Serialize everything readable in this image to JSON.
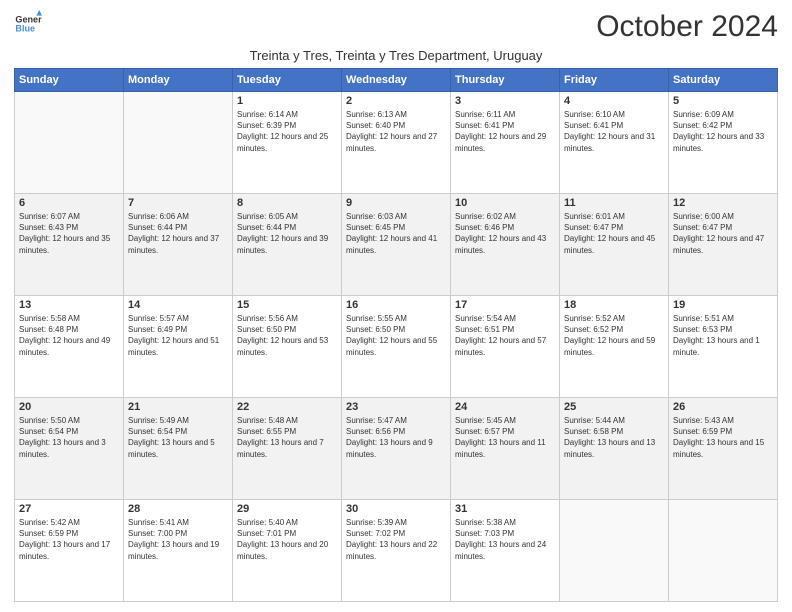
{
  "logo": {
    "line1": "General",
    "line2": "Blue"
  },
  "title": "October 2024",
  "subtitle": "Treinta y Tres, Treinta y Tres Department, Uruguay",
  "days_of_week": [
    "Sunday",
    "Monday",
    "Tuesday",
    "Wednesday",
    "Thursday",
    "Friday",
    "Saturday"
  ],
  "weeks": [
    [
      {
        "day": "",
        "info": ""
      },
      {
        "day": "",
        "info": ""
      },
      {
        "day": "1",
        "info": "Sunrise: 6:14 AM\nSunset: 6:39 PM\nDaylight: 12 hours and 25 minutes."
      },
      {
        "day": "2",
        "info": "Sunrise: 6:13 AM\nSunset: 6:40 PM\nDaylight: 12 hours and 27 minutes."
      },
      {
        "day": "3",
        "info": "Sunrise: 6:11 AM\nSunset: 6:41 PM\nDaylight: 12 hours and 29 minutes."
      },
      {
        "day": "4",
        "info": "Sunrise: 6:10 AM\nSunset: 6:41 PM\nDaylight: 12 hours and 31 minutes."
      },
      {
        "day": "5",
        "info": "Sunrise: 6:09 AM\nSunset: 6:42 PM\nDaylight: 12 hours and 33 minutes."
      }
    ],
    [
      {
        "day": "6",
        "info": "Sunrise: 6:07 AM\nSunset: 6:43 PM\nDaylight: 12 hours and 35 minutes."
      },
      {
        "day": "7",
        "info": "Sunrise: 6:06 AM\nSunset: 6:44 PM\nDaylight: 12 hours and 37 minutes."
      },
      {
        "day": "8",
        "info": "Sunrise: 6:05 AM\nSunset: 6:44 PM\nDaylight: 12 hours and 39 minutes."
      },
      {
        "day": "9",
        "info": "Sunrise: 6:03 AM\nSunset: 6:45 PM\nDaylight: 12 hours and 41 minutes."
      },
      {
        "day": "10",
        "info": "Sunrise: 6:02 AM\nSunset: 6:46 PM\nDaylight: 12 hours and 43 minutes."
      },
      {
        "day": "11",
        "info": "Sunrise: 6:01 AM\nSunset: 6:47 PM\nDaylight: 12 hours and 45 minutes."
      },
      {
        "day": "12",
        "info": "Sunrise: 6:00 AM\nSunset: 6:47 PM\nDaylight: 12 hours and 47 minutes."
      }
    ],
    [
      {
        "day": "13",
        "info": "Sunrise: 5:58 AM\nSunset: 6:48 PM\nDaylight: 12 hours and 49 minutes."
      },
      {
        "day": "14",
        "info": "Sunrise: 5:57 AM\nSunset: 6:49 PM\nDaylight: 12 hours and 51 minutes."
      },
      {
        "day": "15",
        "info": "Sunrise: 5:56 AM\nSunset: 6:50 PM\nDaylight: 12 hours and 53 minutes."
      },
      {
        "day": "16",
        "info": "Sunrise: 5:55 AM\nSunset: 6:50 PM\nDaylight: 12 hours and 55 minutes."
      },
      {
        "day": "17",
        "info": "Sunrise: 5:54 AM\nSunset: 6:51 PM\nDaylight: 12 hours and 57 minutes."
      },
      {
        "day": "18",
        "info": "Sunrise: 5:52 AM\nSunset: 6:52 PM\nDaylight: 12 hours and 59 minutes."
      },
      {
        "day": "19",
        "info": "Sunrise: 5:51 AM\nSunset: 6:53 PM\nDaylight: 13 hours and 1 minute."
      }
    ],
    [
      {
        "day": "20",
        "info": "Sunrise: 5:50 AM\nSunset: 6:54 PM\nDaylight: 13 hours and 3 minutes."
      },
      {
        "day": "21",
        "info": "Sunrise: 5:49 AM\nSunset: 6:54 PM\nDaylight: 13 hours and 5 minutes."
      },
      {
        "day": "22",
        "info": "Sunrise: 5:48 AM\nSunset: 6:55 PM\nDaylight: 13 hours and 7 minutes."
      },
      {
        "day": "23",
        "info": "Sunrise: 5:47 AM\nSunset: 6:56 PM\nDaylight: 13 hours and 9 minutes."
      },
      {
        "day": "24",
        "info": "Sunrise: 5:45 AM\nSunset: 6:57 PM\nDaylight: 13 hours and 11 minutes."
      },
      {
        "day": "25",
        "info": "Sunrise: 5:44 AM\nSunset: 6:58 PM\nDaylight: 13 hours and 13 minutes."
      },
      {
        "day": "26",
        "info": "Sunrise: 5:43 AM\nSunset: 6:59 PM\nDaylight: 13 hours and 15 minutes."
      }
    ],
    [
      {
        "day": "27",
        "info": "Sunrise: 5:42 AM\nSunset: 6:59 PM\nDaylight: 13 hours and 17 minutes."
      },
      {
        "day": "28",
        "info": "Sunrise: 5:41 AM\nSunset: 7:00 PM\nDaylight: 13 hours and 19 minutes."
      },
      {
        "day": "29",
        "info": "Sunrise: 5:40 AM\nSunset: 7:01 PM\nDaylight: 13 hours and 20 minutes."
      },
      {
        "day": "30",
        "info": "Sunrise: 5:39 AM\nSunset: 7:02 PM\nDaylight: 13 hours and 22 minutes."
      },
      {
        "day": "31",
        "info": "Sunrise: 5:38 AM\nSunset: 7:03 PM\nDaylight: 13 hours and 24 minutes."
      },
      {
        "day": "",
        "info": ""
      },
      {
        "day": "",
        "info": ""
      }
    ]
  ]
}
